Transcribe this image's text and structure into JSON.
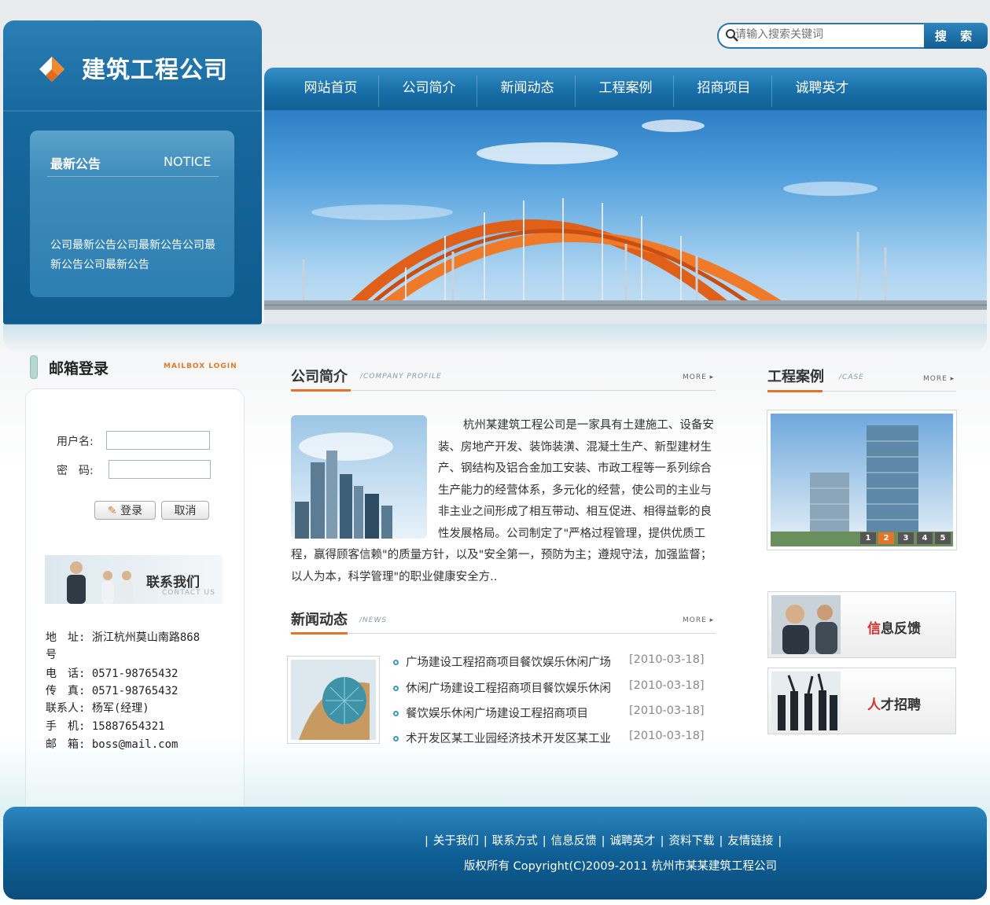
{
  "brand": {
    "name": "建筑工程公司"
  },
  "notice": {
    "title": "最新公告",
    "title_en": "NOTICE",
    "body": "公司最新公告公司最新公告公司最新公告公司最新公告"
  },
  "search": {
    "placeholder": "请输入搜索关键词",
    "button_label": "搜 索"
  },
  "nav": {
    "items": [
      "网站首页",
      "公司简介",
      "新闻动态",
      "工程案例",
      "招商项目",
      "诚聘英才"
    ]
  },
  "mailbox": {
    "title": "邮箱登录",
    "title_en": "MAILBOX LOGIN",
    "username_label": "用户名:",
    "password_label": "密　码:",
    "login_label": "登录",
    "cancel_label": "取消"
  },
  "contact": {
    "title": "联系我们",
    "title_en": "CONTACT US",
    "lines": [
      "地　址: 浙江杭州莫山南路868",
      "号",
      "电　话: 0571-98765432",
      "传　真: 0571-98765432",
      "联系人: 杨军(经理)",
      "手　机: 15887654321",
      "邮　箱: boss@mail.com"
    ]
  },
  "about": {
    "title": "公司简介",
    "title_en": "/COMPANY PROFILE",
    "more": "MORE",
    "text": "杭州某建筑工程公司是一家具有土建施工、设备安装、房地产开发、装饰装潢、混凝土生产、新型建材生产、钢结构及铝合金加工安装、市政工程等一系列综合生产能力的经营体系，多元化的经营，使公司的主业与非主业之间形成了相互带动、相互促进、相得益彰的良性发展格局。公司制定了\"严格过程管理，提供优质工程，赢得顾客信赖\"的质量方针，以及\"安全第一，预防为主；遵规守法，加强监督；以人为本，科学管理\"的职业健康安全方.."
  },
  "news": {
    "title": "新闻动态",
    "title_en": "/NEWS",
    "more": "MORE",
    "items": [
      {
        "title": "广场建设工程招商项目餐饮娱乐休闲广场",
        "date": "[2010-03-18]"
      },
      {
        "title": "休闲广场建设工程招商项目餐饮娱乐休闲",
        "date": "[2010-03-18]"
      },
      {
        "title": "餐饮娱乐休闲广场建设工程招商项目",
        "date": "[2010-03-18]"
      },
      {
        "title": "术开发区某工业园经济技术开发区某工业",
        "date": "[2010-03-18]"
      }
    ]
  },
  "cases": {
    "title": "工程案例",
    "title_en": "/CASE",
    "more": "MORE",
    "pages": [
      "1",
      "2",
      "3",
      "4",
      "5"
    ],
    "active_page": "2"
  },
  "side": {
    "feedback": "信息反馈",
    "jobs": "人才招聘"
  },
  "footer": {
    "links": [
      "关于我们",
      "联系方式",
      "信息反馈",
      "诚聘英才",
      "资料下载",
      "友情链接"
    ],
    "copyright": "版权所有 Copyright(C)2009-2011 杭州市某某建筑工程公司"
  },
  "colors": {
    "brand_blue": "#0f5f95",
    "accent_orange": "#e6732a"
  }
}
